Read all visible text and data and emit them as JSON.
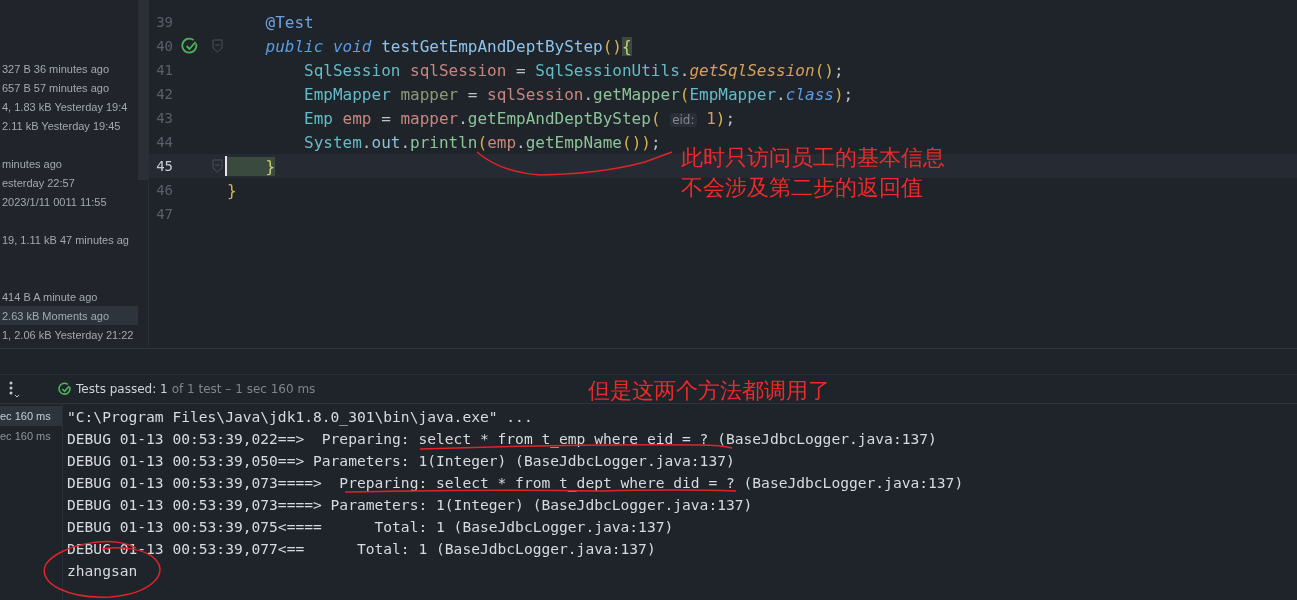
{
  "file_list": {
    "rows": [
      {
        "kind": "blank"
      },
      {
        "kind": "file",
        "text": "327 B 36 minutes ago",
        "selected": false
      },
      {
        "kind": "file",
        "text": "657 B 57 minutes ago",
        "selected": false
      },
      {
        "kind": "file",
        "text": "4, 1.83 kB Yesterday 19:4",
        "selected": false
      },
      {
        "kind": "file",
        "text": "2.11 kB Yesterday 19:45",
        "selected": false
      },
      {
        "kind": "blank"
      },
      {
        "kind": "file",
        "text": "minutes ago",
        "selected": false
      },
      {
        "kind": "file",
        "text": "esterday 22:57",
        "selected": false
      },
      {
        "kind": "file",
        "text": "2023/1/11 0011 11:55",
        "selected": false
      },
      {
        "kind": "blank"
      },
      {
        "kind": "file",
        "text": "19, 1.11 kB 47 minutes ag",
        "selected": false
      },
      {
        "kind": "blank"
      },
      {
        "kind": "blank"
      },
      {
        "kind": "file",
        "text": "414 B A minute ago",
        "selected": false
      },
      {
        "kind": "file",
        "text": "2.63 kB Moments ago",
        "selected": true
      },
      {
        "kind": "file",
        "text": "1, 2.06 kB Yesterday 21:22",
        "selected": false
      }
    ]
  },
  "editor": {
    "lines": [
      {
        "number": "39",
        "current": false,
        "fold": false,
        "caret": false,
        "tokens": [
          {
            "t": "    @Test",
            "kind": "annotation"
          }
        ]
      },
      {
        "number": "40",
        "current": false,
        "fold": true,
        "caret": false,
        "gutter_icon": {
          "kind": "test-passed"
        },
        "tokens": [
          {
            "t": "    public ",
            "kind": "keyword"
          },
          {
            "t": "void ",
            "kind": "keyword"
          },
          {
            "t": "testGetEmpAndDeptByStep",
            "kind": "method-decl"
          },
          {
            "t": "()",
            "kind": "paren"
          },
          {
            "t": "{",
            "kind": "brace-match"
          }
        ]
      },
      {
        "number": "41",
        "current": false,
        "fold": false,
        "caret": false,
        "tokens": [
          {
            "t": "        SqlSession ",
            "kind": "type"
          },
          {
            "t": "sqlSession",
            "kind": "variable",
            "color": "#c9867f"
          },
          {
            "t": " = ",
            "kind": "punct"
          },
          {
            "t": "SqlSessionUtils",
            "kind": "type"
          },
          {
            "t": ".",
            "kind": "punct"
          },
          {
            "t": "getSqlSession",
            "kind": "static-method"
          },
          {
            "t": "()",
            "kind": "paren"
          },
          {
            "t": ";",
            "kind": "punct"
          }
        ]
      },
      {
        "number": "42",
        "current": false,
        "fold": false,
        "caret": false,
        "tokens": [
          {
            "t": "        EmpMapper ",
            "kind": "type"
          },
          {
            "t": "mapper",
            "kind": "variable",
            "color": "#8c9a7a"
          },
          {
            "t": " = ",
            "kind": "punct"
          },
          {
            "t": "sqlSession",
            "kind": "variable",
            "color": "#c9867f"
          },
          {
            "t": ".",
            "kind": "punct"
          },
          {
            "t": "getMapper",
            "kind": "method"
          },
          {
            "t": "(",
            "kind": "paren"
          },
          {
            "t": "EmpMapper",
            "kind": "type"
          },
          {
            "t": ".",
            "kind": "punct"
          },
          {
            "t": "class",
            "kind": "keyword"
          },
          {
            "t": ")",
            "kind": "paren"
          },
          {
            "t": ";",
            "kind": "punct"
          }
        ]
      },
      {
        "number": "43",
        "current": false,
        "fold": false,
        "caret": false,
        "tokens": [
          {
            "t": "        Emp ",
            "kind": "type"
          },
          {
            "t": "emp",
            "kind": "variable",
            "color": "#c9867f"
          },
          {
            "t": " = ",
            "kind": "punct"
          },
          {
            "t": "mapper",
            "kind": "variable",
            "color": "#c9867f"
          },
          {
            "t": ".",
            "kind": "punct"
          },
          {
            "t": "getEmpAndDeptByStep",
            "kind": "method"
          },
          {
            "t": "( ",
            "kind": "paren"
          },
          {
            "t": "eid:",
            "kind": "hint"
          },
          {
            "t": " 1",
            "kind": "number"
          },
          {
            "t": ")",
            "kind": "paren"
          },
          {
            "t": ";",
            "kind": "punct"
          }
        ]
      },
      {
        "number": "44",
        "current": false,
        "fold": false,
        "caret": false,
        "tokens": [
          {
            "t": "        System",
            "kind": "type"
          },
          {
            "t": ".",
            "kind": "punct"
          },
          {
            "t": "out",
            "kind": "field"
          },
          {
            "t": ".",
            "kind": "punct"
          },
          {
            "t": "println",
            "kind": "method"
          },
          {
            "t": "(",
            "kind": "paren"
          },
          {
            "t": "emp",
            "kind": "variable",
            "color": "#c9867f"
          },
          {
            "t": ".",
            "kind": "punct"
          },
          {
            "t": "getEmpName",
            "kind": "method"
          },
          {
            "t": "())",
            "kind": "paren"
          },
          {
            "t": ";",
            "kind": "punct"
          }
        ]
      },
      {
        "number": "45",
        "current": true,
        "fold": true,
        "caret": true,
        "tokens": [
          {
            "t": "    }",
            "kind": "brace-match"
          }
        ]
      },
      {
        "number": "46",
        "current": false,
        "fold": false,
        "caret": false,
        "tokens": [
          {
            "t": "}",
            "kind": "paren"
          }
        ]
      },
      {
        "number": "47",
        "current": false,
        "fold": false,
        "caret": false
      }
    ]
  },
  "test_toolbar": {
    "status": "Tests passed: 1",
    "detail": "of 1 test – 1 sec 160 ms"
  },
  "test_tree": {
    "items": [
      {
        "text": "ec 160 ms",
        "selected": true
      },
      {
        "text": "ec 160 ms",
        "selected": false
      }
    ]
  },
  "console": {
    "lines": [
      "\"C:\\Program Files\\Java\\jdk1.8.0_301\\bin\\java.exe\" ...",
      "DEBUG 01-13 00:53:39,022==>  Preparing: select * from t_emp where eid = ? (BaseJdbcLogger.java:137)",
      "DEBUG 01-13 00:53:39,050==> Parameters: 1(Integer) (BaseJdbcLogger.java:137)",
      "DEBUG 01-13 00:53:39,073====>  Preparing: select * from t_dept where did = ? (BaseJdbcLogger.java:137)",
      "DEBUG 01-13 00:53:39,073====> Parameters: 1(Integer) (BaseJdbcLogger.java:137)",
      "DEBUG 01-13 00:53:39,075<====      Total: 1 (BaseJdbcLogger.java:137)",
      "DEBUG 01-13 00:53:39,077<==      Total: 1 (BaseJdbcLogger.java:137)",
      "zhangsan"
    ]
  },
  "annotations": [
    {
      "kind": "note",
      "text": "此时只访问员工的基本信息"
    },
    {
      "kind": "note",
      "text": "不会涉及第二步的返回值"
    },
    {
      "kind": "note",
      "text": "但是这两个方法都调用了"
    }
  ]
}
